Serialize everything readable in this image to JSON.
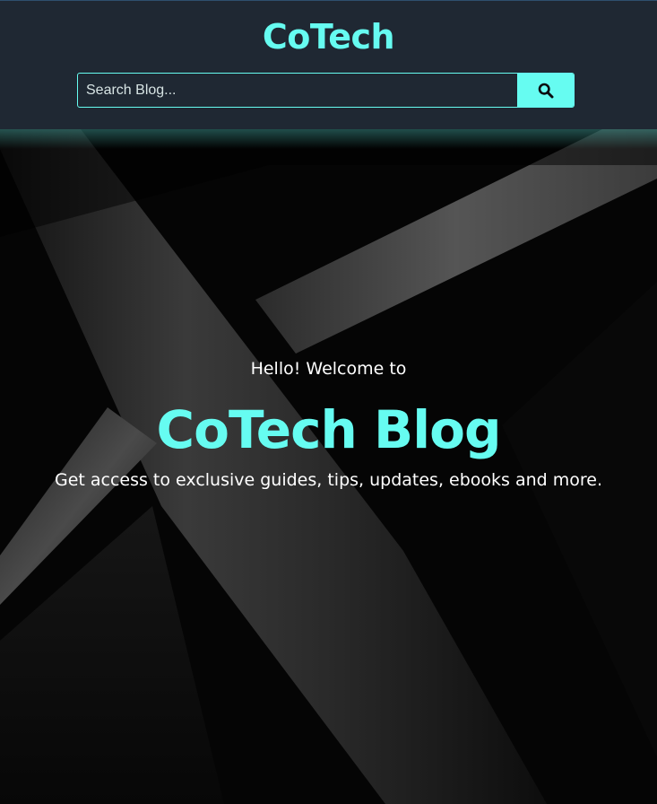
{
  "header": {
    "brand": "CoTech",
    "search": {
      "placeholder": "Search Blog...",
      "value": "",
      "button_icon": "search-icon"
    }
  },
  "hero": {
    "greeting": "Hello! Welcome to",
    "title": "CoTech Blog",
    "tagline": "Get access to exclusive guides, tips, updates, ebooks and more."
  },
  "colors": {
    "accent": "#66fcf1",
    "header_bg": "#1f2833",
    "hero_bg": "#050505",
    "text": "#ffffff"
  }
}
